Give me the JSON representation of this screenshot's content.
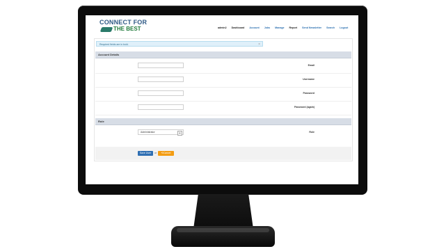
{
  "logo": {
    "line1": "CONNECT FOR",
    "line2": "THE BEST"
  },
  "nav": {
    "items": [
      {
        "label": "admin2",
        "style": "dark"
      },
      {
        "label": "Dashboard",
        "style": "dark"
      },
      {
        "label": "Account",
        "style": "link"
      },
      {
        "label": "Jobs",
        "style": "link"
      },
      {
        "label": "Manage",
        "style": "link"
      },
      {
        "label": "Report",
        "style": "dark"
      },
      {
        "label": "Send Newsletter",
        "style": "link"
      },
      {
        "label": "Search",
        "style": "link"
      },
      {
        "label": "Logout",
        "style": "link"
      }
    ]
  },
  "alert": {
    "text": "Required fields are in bold.",
    "close": "×"
  },
  "sections": {
    "account": "Account Details",
    "role": "Role"
  },
  "fields": {
    "email": {
      "label": "Email",
      "value": ""
    },
    "username": {
      "label": "Username",
      "value": ""
    },
    "password": {
      "label": "Password",
      "value": ""
    },
    "password_again": {
      "label": "Password (again)",
      "value": ""
    },
    "role": {
      "label": "Role",
      "value": "Administrator"
    }
  },
  "actions": {
    "save": "Save User",
    "or": "or",
    "cancel": "Cancel"
  },
  "colors": {
    "primary": "#2f6fb3",
    "cancel": "#f39c12",
    "section_bar": "#d7dde6",
    "alert_bg": "#dff0fa"
  }
}
